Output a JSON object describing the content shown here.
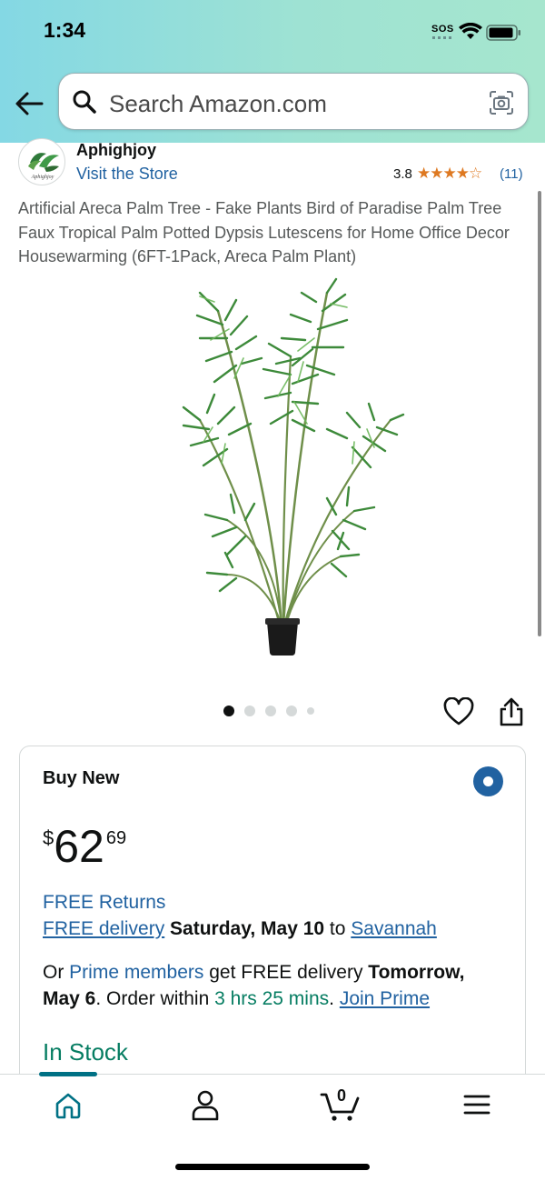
{
  "status_bar": {
    "time": "1:34",
    "sos": "SOS",
    "icons": [
      "wifi-icon",
      "battery-icon"
    ]
  },
  "header": {
    "search_placeholder": "Search Amazon.com",
    "icons": [
      "back-arrow-icon",
      "search-icon",
      "camera-icon"
    ],
    "gradient_colors": [
      "#84d8e4",
      "#a6e6ce"
    ]
  },
  "store": {
    "name": "Aphighjoy",
    "visit_label": "Visit the Store",
    "rating": "3.8",
    "stars_filled": 3.8,
    "review_count": "(11)"
  },
  "product": {
    "title": "Artificial Areca Palm Tree - Fake Plants Bird of Paradise Palm Tree Faux Tropical Palm Potted Dypsis Lutescens for Home Office Decor Housewarming (6FT-1Pack, Areca Palm Plant)",
    "image_count": 5,
    "active_image": 1
  },
  "buy_box": {
    "heading": "Buy New",
    "price_symbol": "$",
    "price_whole": "62",
    "price_fraction": "69",
    "free_returns": "FREE Returns",
    "free_delivery_link": "FREE delivery",
    "delivery_date": "Saturday, May 10",
    "delivery_to": "to",
    "delivery_location": "Savannah",
    "prime_or": "Or",
    "prime_members": "Prime members",
    "prime_get": "get FREE delivery",
    "prime_date": "Tomorrow, May 6",
    "prime_order_within": ". Order within",
    "prime_time": "3 hrs 25 mins",
    "join_prime": "Join Prime",
    "stock_status": "In Stock"
  },
  "bottom_nav": {
    "items": [
      "home-icon",
      "account-icon",
      "cart-icon",
      "menu-icon"
    ],
    "cart_count": "0",
    "active": "home"
  },
  "colors": {
    "link": "#2162a1",
    "star": "#de7921",
    "in_stock": "#067d62",
    "nav_active": "#007185"
  }
}
